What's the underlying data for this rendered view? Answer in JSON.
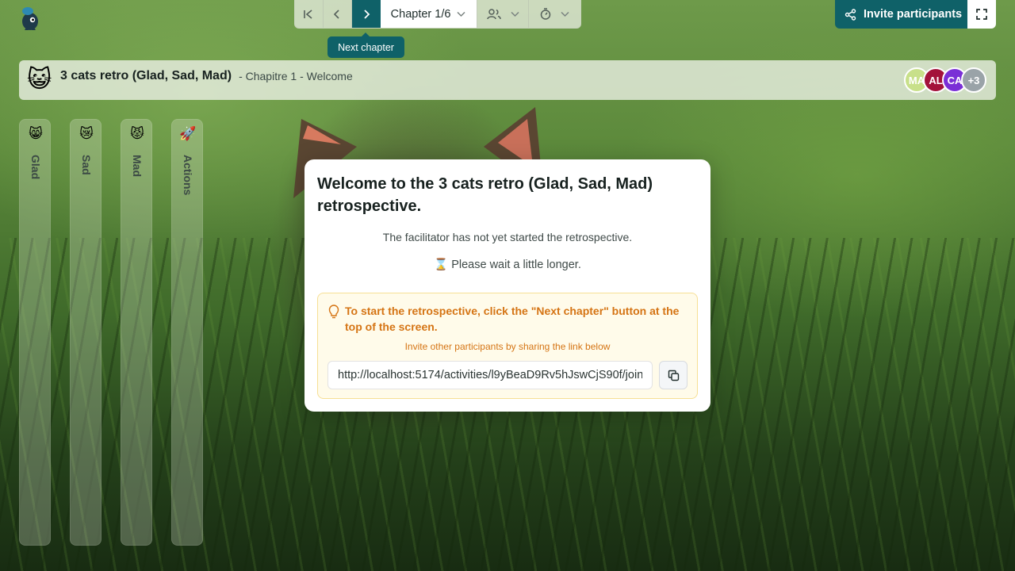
{
  "toolbar": {
    "chapter_label": "Chapter 1/6",
    "tooltip": "Next chapter",
    "icons": [
      "first-chapter-icon",
      "previous-icon",
      "next-icon",
      "users-icon",
      "timer-icon"
    ]
  },
  "actions": {
    "invite_label": "Invite participants"
  },
  "header": {
    "emoji": "😺",
    "title": "3 cats retro (Glad, Sad, Mad)",
    "subtitle": "- Chapitre 1 - Welcome",
    "avatars": [
      {
        "initials": "MA",
        "color": "#c8e08a"
      },
      {
        "initials": "AL",
        "color": "#a3123a"
      },
      {
        "initials": "CA",
        "color": "#7a2fd6"
      },
      {
        "initials": "+3",
        "color": "#9aa3a8"
      }
    ]
  },
  "columns": [
    {
      "label": "Glad",
      "emoji": "😸"
    },
    {
      "label": "Sad",
      "emoji": "😿"
    },
    {
      "label": "Mad",
      "emoji": "😾"
    },
    {
      "label": "Actions",
      "emoji": "🚀"
    }
  ],
  "modal": {
    "title": "Welcome to the 3 cats retro (Glad, Sad, Mad) retrospective.",
    "status": "The facilitator has not yet started the retrospective.",
    "wait": "⌛ Please wait a little longer.",
    "tip": "To start the retrospective, click the \"Next chapter\" button at the top of the screen.",
    "invite_hint": "Invite other participants by sharing the link below",
    "link": "http://localhost:5174/activities/l9yBeaD9Rv5hJswCjS90f/join"
  },
  "colors": {
    "accent": "#0f6168",
    "tip_text": "#d57414",
    "tip_bg": "#fffbea"
  }
}
